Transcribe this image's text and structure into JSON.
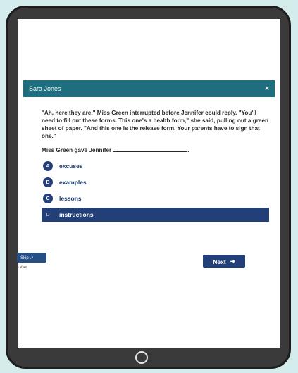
{
  "dialog": {
    "title": "Sara Jones",
    "close_glyph": "×"
  },
  "passage": "\"Ah, here they are,\" Miss Green interrupted before Jennifer could reply. \"You'll need to fill out these forms. This one's a health form,\" she said, pulling out a green sheet of paper. \"And this one is the release form. Your parents have to sign that one.\"",
  "question": {
    "text": "Miss Green gave Jennifer",
    "end": "."
  },
  "options": [
    {
      "letter": "A",
      "label": "excuses"
    },
    {
      "letter": "B",
      "label": "examples"
    },
    {
      "letter": "C",
      "label": "lessons"
    },
    {
      "letter": "D",
      "label": "instructions"
    }
  ],
  "skip": {
    "label": "Skip ↗",
    "page": "3 of 10"
  },
  "next": {
    "label": "Next",
    "arrow": "➜"
  }
}
